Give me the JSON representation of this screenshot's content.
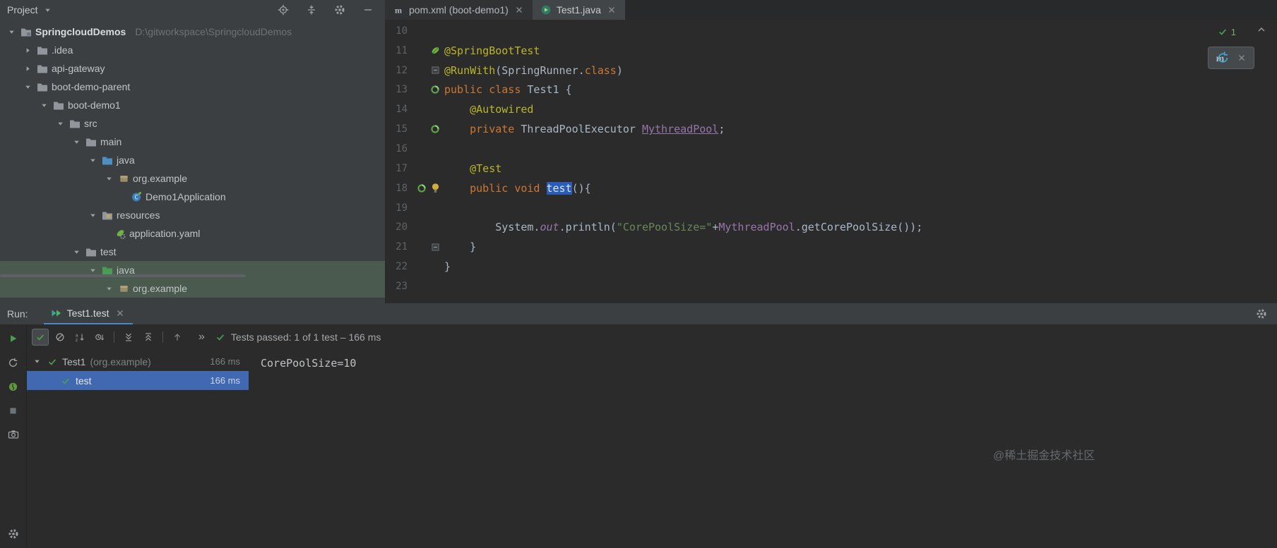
{
  "project_panel": {
    "header": {
      "title": "Project",
      "icons": [
        "locate-icon",
        "collapse-all-header-icon",
        "gear-icon",
        "hide-icon"
      ]
    },
    "tree": [
      {
        "label": "SpringcloudDemos",
        "suffix": "D:\\gitworkspace\\SpringcloudDemos",
        "indent": 0,
        "chevron": "down",
        "icon": "project-icon",
        "root": true
      },
      {
        "label": ".idea",
        "indent": 1,
        "chevron": "right",
        "icon": "folder-icon"
      },
      {
        "label": "api-gateway",
        "indent": 1,
        "chevron": "right",
        "icon": "folder-icon"
      },
      {
        "label": "boot-demo-parent",
        "indent": 1,
        "chevron": "down",
        "icon": "folder-icon"
      },
      {
        "label": "boot-demo1",
        "indent": 2,
        "chevron": "down",
        "icon": "folder-icon"
      },
      {
        "label": "src",
        "indent": 3,
        "chevron": "down",
        "icon": "folder-icon"
      },
      {
        "label": "main",
        "indent": 4,
        "chevron": "down",
        "icon": "folder-icon"
      },
      {
        "label": "java",
        "indent": 5,
        "chevron": "down",
        "icon": "source-folder-icon"
      },
      {
        "label": "org.example",
        "indent": 6,
        "chevron": "down",
        "icon": "package-icon"
      },
      {
        "label": "Demo1Application",
        "indent": 7,
        "chevron": "none",
        "icon": "class-icon"
      },
      {
        "label": "resources",
        "indent": 5,
        "chevron": "down",
        "icon": "resources-folder-icon"
      },
      {
        "label": "application.yaml",
        "indent": 6,
        "chevron": "none",
        "icon": "spring-config-icon"
      },
      {
        "label": "test",
        "indent": 4,
        "chevron": "down",
        "icon": "folder-icon"
      },
      {
        "label": "java",
        "indent": 5,
        "chevron": "down",
        "icon": "test-source-folder-icon",
        "selected": true
      },
      {
        "label": "org.example",
        "indent": 6,
        "chevron": "down",
        "icon": "package-icon",
        "selected": true
      }
    ],
    "scrollbar": "horizontal"
  },
  "editor": {
    "tabs": [
      {
        "label": "pom.xml (boot-demo1)",
        "icon": "maven-icon",
        "active": false
      },
      {
        "label": "Test1.java",
        "icon": "test-class-icon",
        "active": true
      }
    ],
    "inspection_widget": {
      "count": "1"
    },
    "lines": [
      {
        "num": "10",
        "gutter": [],
        "tokens": []
      },
      {
        "num": "11",
        "gutter": [
          "spring-leaf-icon"
        ],
        "tokens": [
          {
            "t": "@SpringBootTest",
            "c": "annotation"
          }
        ]
      },
      {
        "num": "12",
        "gutter": [
          "fold-start-icon"
        ],
        "tokens": [
          {
            "t": "@RunWith",
            "c": "annotation"
          },
          {
            "t": "(SpringRunner.",
            "c": "plain"
          },
          {
            "t": "class",
            "c": "keyword"
          },
          {
            "t": ")",
            "c": "plain"
          }
        ]
      },
      {
        "num": "13",
        "gutter": [
          "bean-icon"
        ],
        "tokens": [
          {
            "t": "public class ",
            "c": "keyword"
          },
          {
            "t": "Test1 {",
            "c": "plain"
          }
        ]
      },
      {
        "num": "14",
        "gutter": [],
        "tokens": [
          {
            "t": "    ",
            "c": "plain"
          },
          {
            "t": "@Autowired",
            "c": "annotation"
          }
        ]
      },
      {
        "num": "15",
        "gutter": [
          "bean-icon"
        ],
        "tokens": [
          {
            "t": "    ",
            "c": "plain"
          },
          {
            "t": "private ",
            "c": "keyword"
          },
          {
            "t": "ThreadPoolExecutor ",
            "c": "plain"
          },
          {
            "t": "MythreadPool",
            "c": "field-underline"
          },
          {
            "t": ";",
            "c": "plain"
          }
        ]
      },
      {
        "num": "16",
        "gutter": [],
        "tokens": []
      },
      {
        "num": "17",
        "gutter": [],
        "tokens": [
          {
            "t": "    ",
            "c": "plain"
          },
          {
            "t": "@Test",
            "c": "annotation"
          }
        ]
      },
      {
        "num": "18",
        "gutter": [
          "bean-icon",
          "bulb-icon"
        ],
        "tokens": [
          {
            "t": "    ",
            "c": "plain"
          },
          {
            "t": "public void ",
            "c": "keyword"
          },
          {
            "t": "test",
            "c": "selected"
          },
          {
            "t": "(){",
            "c": "plain"
          }
        ]
      },
      {
        "num": "19",
        "gutter": [],
        "tokens": []
      },
      {
        "num": "20",
        "gutter": [],
        "tokens": [
          {
            "t": "        System.",
            "c": "plain"
          },
          {
            "t": "out",
            "c": "static-field"
          },
          {
            "t": ".println(",
            "c": "plain"
          },
          {
            "t": "\"CorePoolSize=\"",
            "c": "string"
          },
          {
            "t": "+",
            "c": "plain"
          },
          {
            "t": "MythreadPool",
            "c": "field"
          },
          {
            "t": ".getCorePoolSize());",
            "c": "plain"
          }
        ]
      },
      {
        "num": "21",
        "gutter": [
          "fold-end-icon"
        ],
        "tokens": [
          {
            "t": "    }",
            "c": "plain"
          }
        ]
      },
      {
        "num": "22",
        "gutter": [],
        "tokens": [
          {
            "t": "}",
            "c": "plain"
          }
        ]
      },
      {
        "num": "23",
        "gutter": [],
        "tokens": []
      }
    ]
  },
  "run_panel": {
    "label": "Run:",
    "tab": {
      "label": "Test1.test",
      "icon": "run-test-icon"
    },
    "side_icons": [
      "rerun-icon",
      "rerun-failed-icon",
      "spring-boot-icon",
      "stop-icon",
      "screenshot-icon",
      "gear-icon"
    ],
    "toolbar": {
      "icons": [
        "show-passed-icon",
        "show-ignored-icon",
        "sort-alphabetically-icon",
        "sort-by-duration-icon",
        "divider",
        "expand-all-icon",
        "collapse-all-icon",
        "divider",
        "navigate-up-icon"
      ],
      "active_icon": "show-passed-icon",
      "chevrons": "»",
      "status": "Tests passed: 1 of 1 test – 166 ms"
    },
    "tree": [
      {
        "label": "Test1",
        "suffix": " (org.example)",
        "time": "166 ms",
        "indent": 0,
        "chevron": "down",
        "selected": false
      },
      {
        "label": "test",
        "suffix": "",
        "time": "166 ms",
        "indent": 1,
        "chevron": "none",
        "selected": true
      }
    ],
    "console": "CorePoolSize=10"
  },
  "watermark": "@稀土掘金技术社区"
}
